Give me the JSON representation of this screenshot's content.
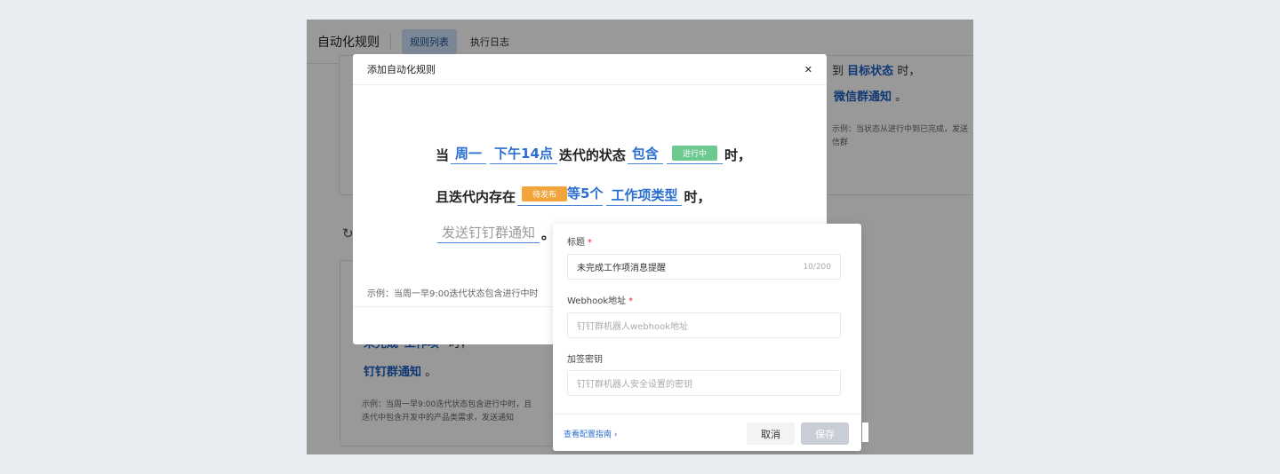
{
  "header": {
    "title": "自动化规则",
    "tabs": [
      "规则列表",
      "执行日志"
    ]
  },
  "background": {
    "card1": {
      "line1_pre": "到",
      "line1_slot": "目标状态",
      "line1_post": "时，",
      "line2_slot": "微信群通知",
      "line2_post": "。",
      "example": "示例：当状态从进行中到已完成，发送",
      "example2": "信群"
    },
    "card2": {
      "line1_slot": "未完成\"工作项\"",
      "line1_post": "时，",
      "line2_slot": "钉钉群通知",
      "line2_post": "。",
      "example": "示例：当周一早9:00迭代状态包含进行中时，且",
      "example2": "迭代中包含开发中的产品类需求，发送通知"
    }
  },
  "modal": {
    "title": "添加自动化规则",
    "rule": {
      "w_when": "当",
      "s_day": "周一",
      "s_time": "下午14点",
      "w_state": "迭代的状态",
      "s_contains": "包含",
      "tag_in_progress": "进行中",
      "w_time1": "时，",
      "w_and": "且迭代内存在",
      "tag_pending": "待发布",
      "s_count": "等5个",
      "s_type": "工作项类型",
      "w_time2": "时，",
      "s_action": "发送钉钉群通知",
      "w_period": "。"
    },
    "example": "示例：当周一早9:00迭代状态包含进行中时"
  },
  "popover": {
    "title_label": "标题",
    "title_value": "未完成工作项消息提醒",
    "title_count": "10/200",
    "webhook_label": "Webhook地址",
    "webhook_placeholder": "钉钉群机器人webhook地址",
    "secret_label": "加签密钥",
    "secret_placeholder": "钉钉群机器人安全设置的密钥",
    "guide_link": "查看配置指南 ›",
    "cancel": "取消",
    "save": "保存"
  },
  "colors": {
    "green_tag": "#6cc98f",
    "orange_tag": "#f0a43a",
    "link": "#2a6fd0"
  }
}
